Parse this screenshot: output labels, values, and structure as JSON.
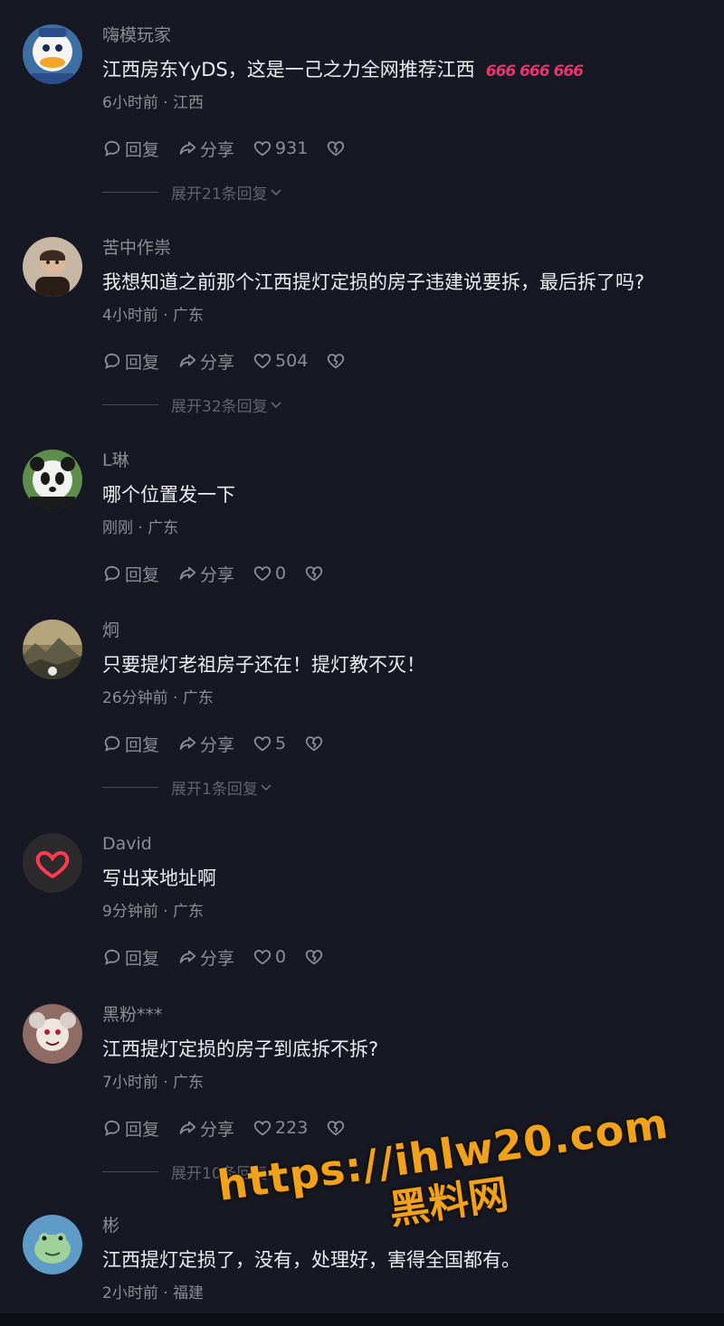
{
  "comments": [
    {
      "username": "嗨模玩家",
      "text": "江西房东YyDS，这是一己之力全网推荐江西",
      "emojis": "666 666 666",
      "time": "6小时前",
      "location": "江西",
      "reply_label": "回复",
      "share_label": "分享",
      "likes": "931",
      "expand_label": "展开21条回复",
      "avatar_icon": "donald-duck-avatar"
    },
    {
      "username": "苦中作祟",
      "text": "我想知道之前那个江西提灯定损的房子违建说要拆，最后拆了吗?",
      "time": "4小时前",
      "location": "广东",
      "reply_label": "回复",
      "share_label": "分享",
      "likes": "504",
      "expand_label": "展开32条回复",
      "avatar_icon": "person-avatar"
    },
    {
      "username": "L琳",
      "text": "哪个位置发一下",
      "time": "刚刚",
      "location": "广东",
      "reply_label": "回复",
      "share_label": "分享",
      "likes": "0",
      "avatar_icon": "panda-avatar"
    },
    {
      "username": "炯",
      "text": "只要提灯老祖房子还在！提灯教不灭！",
      "time": "26分钟前",
      "location": "广东",
      "reply_label": "回复",
      "share_label": "分享",
      "likes": "5",
      "expand_label": "展开1条回复",
      "avatar_icon": "landscape-avatar"
    },
    {
      "username": "David",
      "text": "写出来地址啊",
      "time": "9分钟前",
      "location": "广东",
      "reply_label": "回复",
      "share_label": "分享",
      "likes": "0",
      "avatar_icon": "neon-heart-avatar"
    },
    {
      "username": "黑粉***",
      "text": "江西提灯定损的房子到底拆不拆?",
      "time": "7小时前",
      "location": "广东",
      "reply_label": "回复",
      "share_label": "分享",
      "likes": "223",
      "expand_label": "展开10条回复",
      "avatar_icon": "cartoon-avatar"
    },
    {
      "username": "彬",
      "text": "江西提灯定损了，没有，处理好，害得全国都有。",
      "time": "2小时前",
      "location": "福建",
      "avatar_icon": "frog-avatar"
    }
  ],
  "meta_separator": " · ",
  "watermark": {
    "url": "https://ihlw20.com",
    "name": "黑料网"
  },
  "colors": {
    "background": "#161823",
    "text_primary": "#ececf0",
    "text_secondary": "#8c8d93",
    "emoji_accent": "#e8356e",
    "watermark": "#f0a21c"
  }
}
